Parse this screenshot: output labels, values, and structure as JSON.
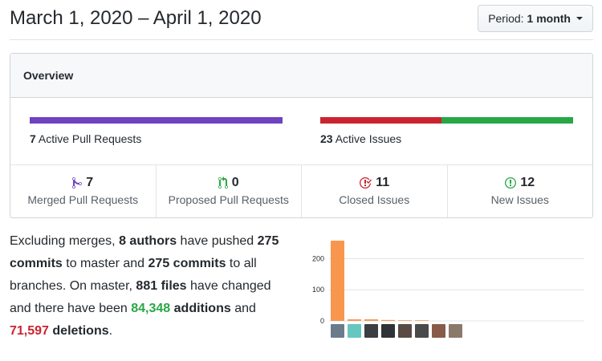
{
  "header": {
    "title": "March 1, 2020 – April 1, 2020",
    "period_label": "Period:",
    "period_value": "1 month"
  },
  "overview": {
    "title": "Overview",
    "pr_count": "7",
    "pr_text": "Active Pull Requests",
    "issues_count": "23",
    "issues_text": "Active Issues",
    "issues_closed_fraction": 0.478,
    "stats": [
      {
        "value": "7",
        "label": "Merged Pull Requests",
        "icon": "git-merge-icon",
        "color": "#6f42c1"
      },
      {
        "value": "0",
        "label": "Proposed Pull Requests",
        "icon": "git-pull-request-icon",
        "color": "#28a745"
      },
      {
        "value": "11",
        "label": "Closed Issues",
        "icon": "issue-closed-icon",
        "color": "#cb2431"
      },
      {
        "value": "12",
        "label": "New Issues",
        "icon": "issue-opened-icon",
        "color": "#28a745"
      }
    ]
  },
  "summary": {
    "p1": "Excluding merges,",
    "authors": "8 authors",
    "p2": "have pushed",
    "commits_master": "275 commits",
    "p3": "to master and",
    "commits_all": "275 commits",
    "p4": "to all branches. On master,",
    "files": "881 files",
    "p5": "have changed and there have been",
    "additions_num": "84,348",
    "additions_word": "additions",
    "p6": "and",
    "deletions_num": "71,597",
    "deletions_word": "deletions",
    "p7": "."
  },
  "colors": {
    "pr": "#6f42c1",
    "closed": "#cb2431",
    "open": "#28a745",
    "bar": "#f9964e"
  },
  "chart_data": {
    "type": "bar",
    "categories": [
      "author-1",
      "author-2",
      "author-3",
      "author-4",
      "author-5",
      "author-6",
      "author-7",
      "author-8"
    ],
    "values": [
      258,
      5,
      5,
      3,
      2,
      2,
      0,
      0
    ],
    "ylim": [
      0,
      258
    ],
    "yticks": [
      "0",
      "100",
      "200"
    ],
    "ytick_values": [
      0,
      100,
      200
    ],
    "grid": true
  }
}
